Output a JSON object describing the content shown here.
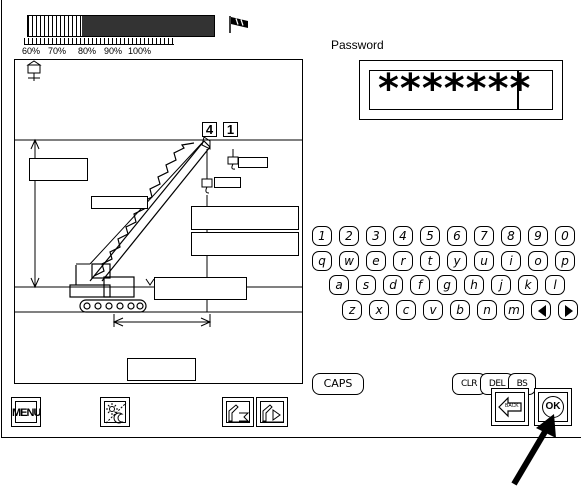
{
  "load_meter": {
    "scale_labels": [
      "60%",
      "70%",
      "80%",
      "90%",
      "100%"
    ],
    "fill_fraction": 0.71
  },
  "boom_status": {
    "label_a": "4",
    "label_b": "1"
  },
  "password": {
    "label": "Password",
    "value": "*******"
  },
  "keyboard": {
    "row1": [
      "1",
      "2",
      "3",
      "4",
      "5",
      "6",
      "7",
      "8",
      "9",
      "0"
    ],
    "row2": [
      "q",
      "w",
      "e",
      "r",
      "t",
      "y",
      "u",
      "i",
      "o",
      "p"
    ],
    "row3": [
      "a",
      "s",
      "d",
      "f",
      "g",
      "h",
      "j",
      "k",
      "l"
    ],
    "row4": [
      "z",
      "x",
      "c",
      "v",
      "b",
      "n",
      "m"
    ],
    "caps": "CAPS",
    "clr": "CLR",
    "del": "DEL",
    "bs": "BS"
  },
  "footer": {
    "menu_label": "MENU",
    "back_label": "BACK",
    "ok_label": "OK"
  }
}
